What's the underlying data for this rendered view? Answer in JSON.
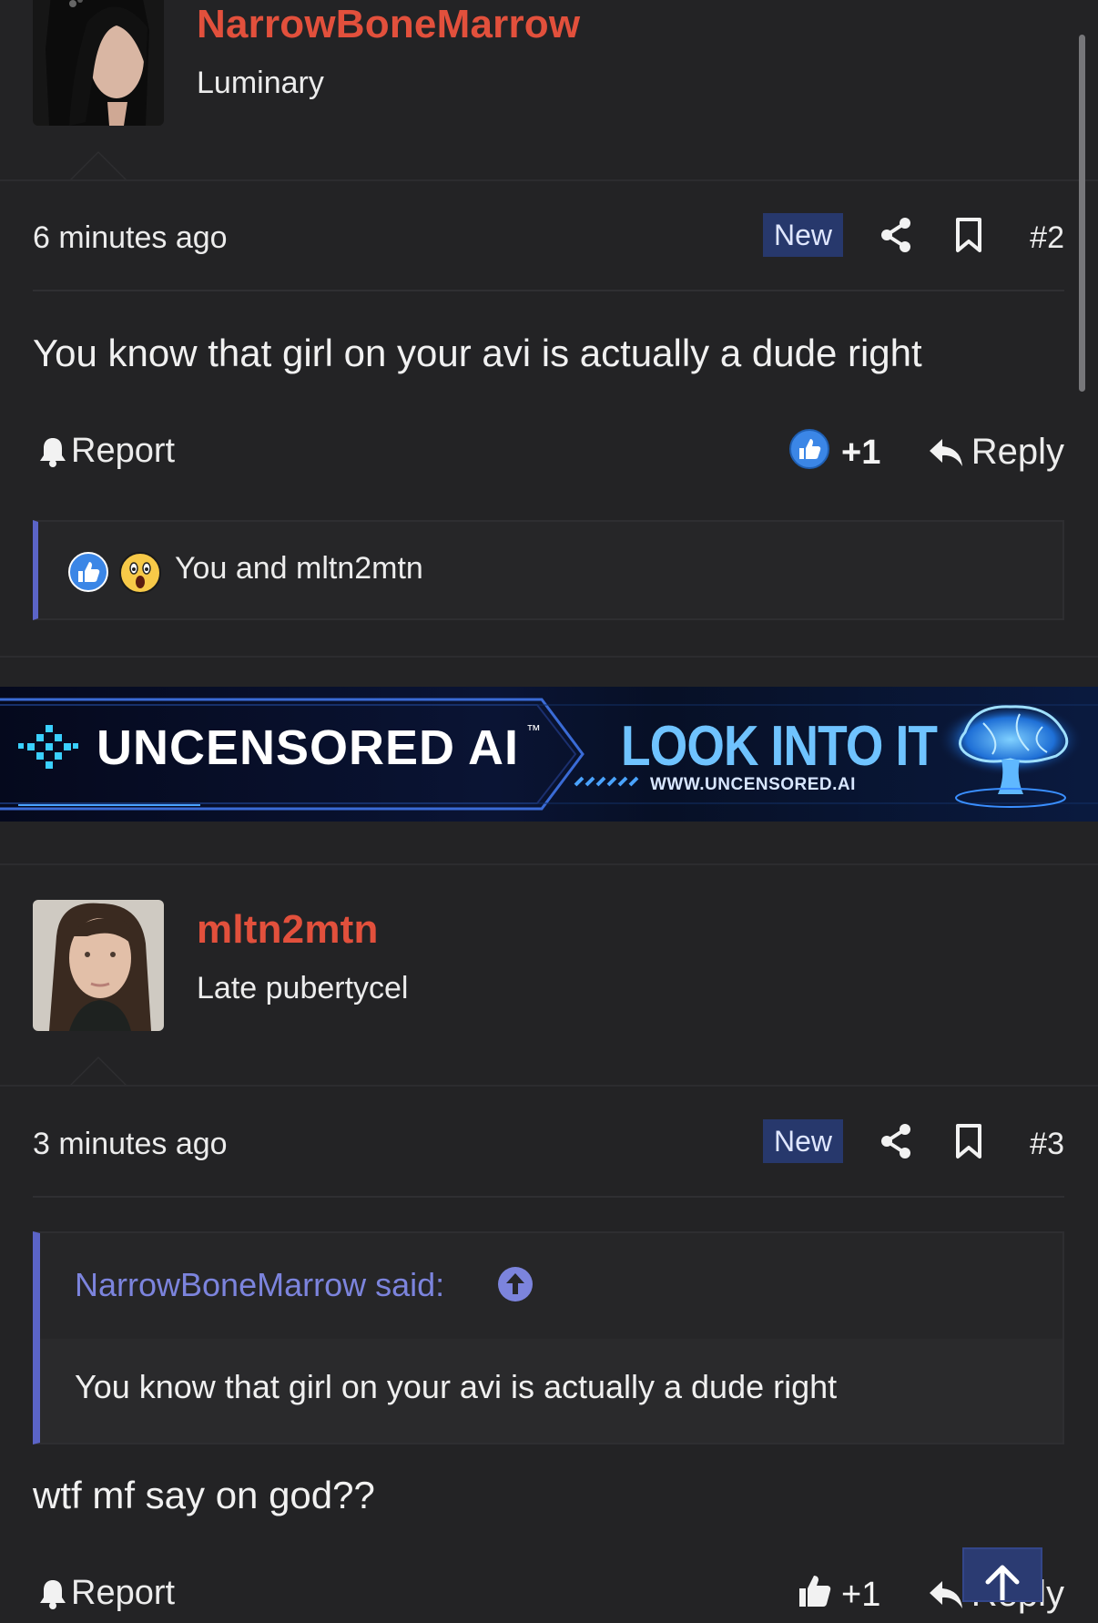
{
  "posts": [
    {
      "username": "NarrowBoneMarrow",
      "user_title": "Luminary",
      "time": "6 minutes ago",
      "badge": "New",
      "post_number": "#2",
      "body": "You know that girl on your avi is actually a dude right",
      "report_label": "Report",
      "reaction_count": "+1",
      "reply_label": "Reply",
      "reactions_summary": "You and mltn2mtn"
    },
    {
      "username": "mltn2mtn",
      "user_title": "Late pubertycel",
      "time": "3 minutes ago",
      "badge": "New",
      "post_number": "#3",
      "quote_author": "NarrowBoneMarrow said:",
      "quote_text": "You know that girl on your avi is actually a dude right",
      "body": "wtf mf say on god??",
      "report_label": "Report",
      "reaction_count": "+1",
      "reply_label": "Reply"
    }
  ],
  "banner": {
    "brand": "UNCENSORED AI",
    "tm": "™",
    "cta": "LOOK INTO IT",
    "url": "WWW.UNCENSORED.AI"
  },
  "colors": {
    "background": "#232325",
    "username": "#e2503c",
    "accent": "#5b64c7",
    "badge_bg": "#27386c",
    "link": "#7c84dd"
  },
  "icons": {
    "share": "share-icon",
    "bookmark": "bookmark-icon",
    "report": "bell-icon",
    "like": "thumbs-up-icon",
    "wow": "wow-face-icon",
    "reply": "reply-arrow-icon",
    "quote_jump": "arrow-up-circle-icon",
    "scroll_top": "arrow-up-icon"
  }
}
